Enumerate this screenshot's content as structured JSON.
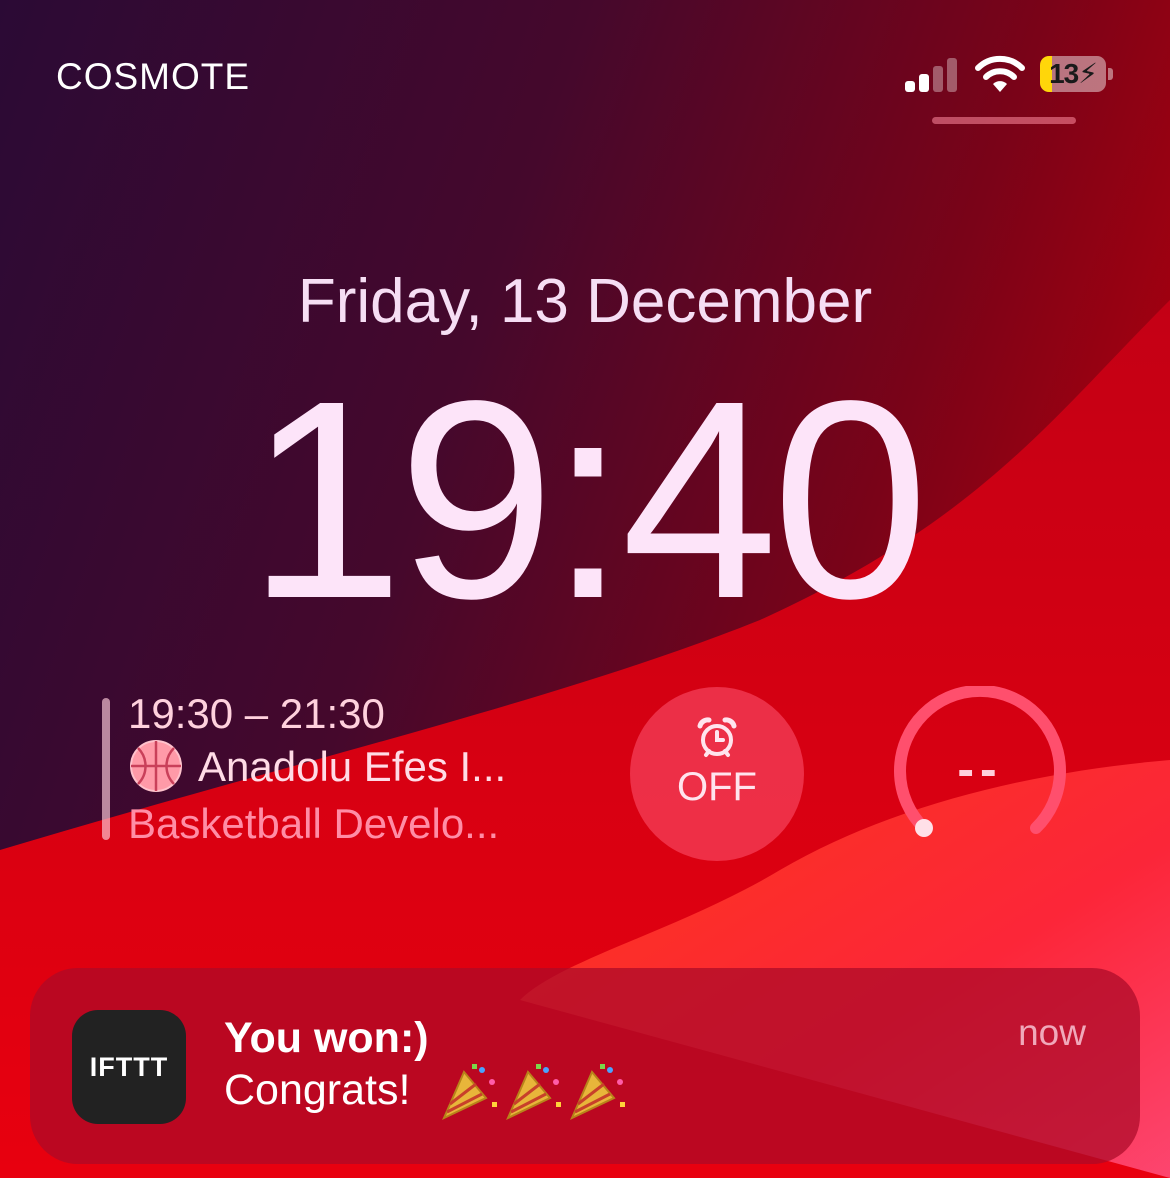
{
  "status_bar": {
    "carrier": "COSMOTE",
    "signal_bars_active": 2,
    "signal_bars_total": 4,
    "battery_level": "13",
    "battery_charging": true,
    "battery_fill_color": "#ffd60a"
  },
  "lock_screen": {
    "date": "Friday, 13 December",
    "time": "19:40"
  },
  "widgets": {
    "calendar": {
      "time_range": "19:30 – 21:30",
      "event_icon": "basketball-icon",
      "event_title": "Anadolu Efes I...",
      "event_subtitle": "Basketball Develo..."
    },
    "alarm": {
      "icon": "alarm-clock-icon",
      "label": "OFF"
    },
    "gauge": {
      "value": "--"
    }
  },
  "notification": {
    "app_icon_label": "IFTTT",
    "title": "You won:)",
    "body": "Congrats!",
    "emoji_icon": "party-popper-icon",
    "emoji_count": 3,
    "timestamp": "now"
  },
  "colors": {
    "accent": "#ff2d55",
    "notification_bg": "#aa0a28"
  }
}
